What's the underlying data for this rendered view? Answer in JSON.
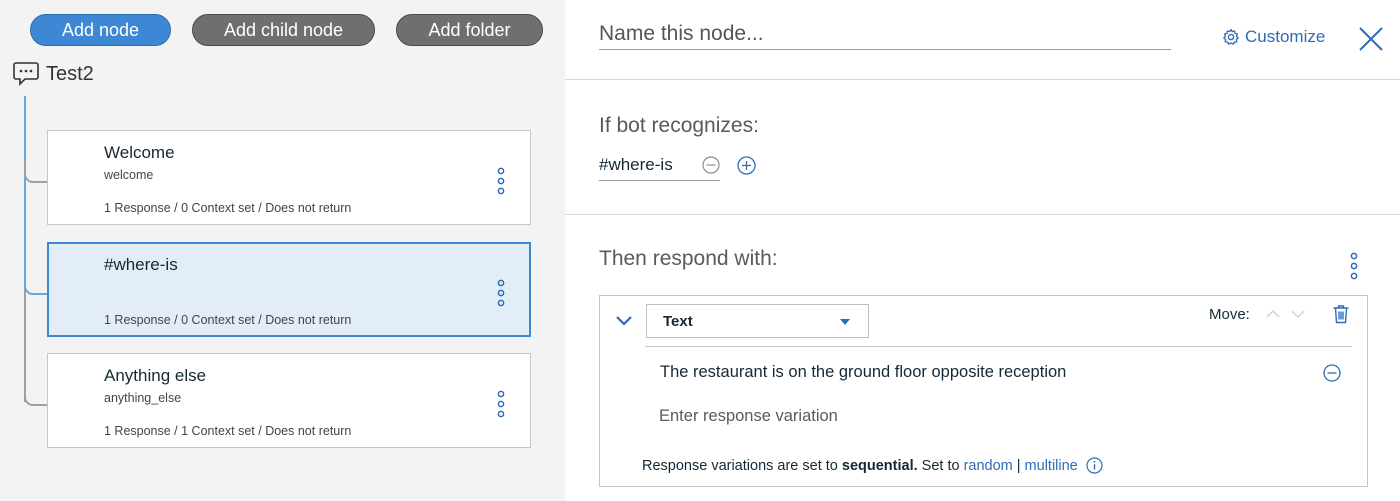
{
  "toolbar": {
    "add_node": "Add node",
    "add_child_node": "Add child node",
    "add_folder": "Add folder"
  },
  "tree": {
    "root_title": "Test2",
    "nodes": [
      {
        "title": "Welcome",
        "condition": "welcome",
        "meta": "1 Response / 0 Context set / Does not return"
      },
      {
        "title": "#where-is",
        "condition": "",
        "meta": "1 Response / 0 Context set / Does not return"
      },
      {
        "title": "Anything else",
        "condition": "anything_else",
        "meta": "1 Response / 1 Context set / Does not return"
      }
    ]
  },
  "editor": {
    "name_placeholder": "Name this node...",
    "customize_label": "Customize",
    "recognizes_label": "If bot recognizes:",
    "intent": "#where-is",
    "respond_label": "Then respond with:",
    "response": {
      "type_selected": "Text",
      "move_label": "Move:",
      "text": "The restaurant is on the ground floor opposite reception",
      "variation_placeholder": "Enter response variation",
      "seq_prefix": "Response variations are set to",
      "seq_mode": "sequential.",
      "seq_setto": "Set to",
      "link_random": "random",
      "link_sep": "|",
      "link_multiline": "multiline"
    }
  },
  "colors": {
    "accent": "#3d87d4",
    "link": "#2d6db5",
    "selected_bg": "#e3edf7",
    "pill_gray": "#6f6f6f"
  }
}
